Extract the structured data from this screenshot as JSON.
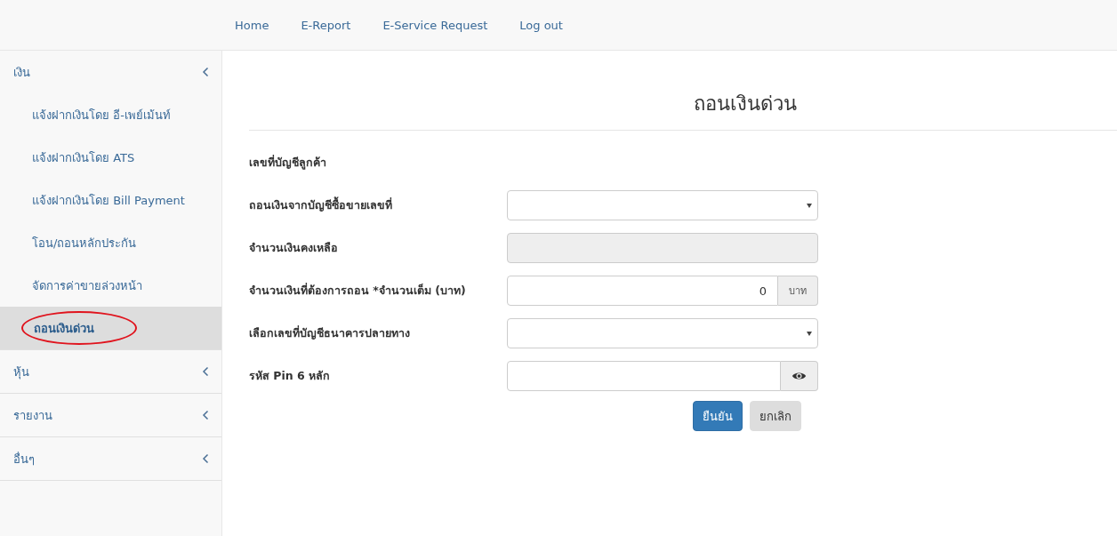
{
  "top_nav": [
    {
      "label": "Home"
    },
    {
      "label": "E-Report"
    },
    {
      "label": "E-Service Request"
    },
    {
      "label": "Log out"
    }
  ],
  "sidebar": {
    "groups": [
      {
        "label": "เงิน",
        "children": [
          {
            "label": "แจ้งฝากเงินโดย อี-เพย์เม้นท์",
            "selected": false,
            "circled": false
          },
          {
            "label": "แจ้งฝากเงินโดย ATS",
            "selected": false,
            "circled": false
          },
          {
            "label": "แจ้งฝากเงินโดย Bill Payment",
            "selected": false,
            "circled": false
          },
          {
            "label": "โอน/ถอนหลักประกัน",
            "selected": false,
            "circled": false
          },
          {
            "label": "จัดการค่าขายล่วงหน้า",
            "selected": false,
            "circled": false
          },
          {
            "label": "ถอนเงินด่วน",
            "selected": true,
            "circled": true
          }
        ]
      },
      {
        "label": "หุ้น"
      },
      {
        "label": "รายงาน"
      },
      {
        "label": "อื่นๆ"
      }
    ]
  },
  "page": {
    "title": "ถอนเงินด่วน",
    "fields": [
      {
        "kind": "label",
        "label": "เลขที่บัญชีลูกค้า"
      },
      {
        "kind": "select",
        "label": "ถอนเงินจากบัญชีซื้อขายเลขที่"
      },
      {
        "kind": "readonly",
        "label": "จำนวนเงินคงเหลือ"
      },
      {
        "kind": "amount",
        "label": "จำนวนเงินที่ต้องการถอน *จำนวนเต็ม (บาท)",
        "value": "0",
        "addon": "บาท"
      },
      {
        "kind": "select",
        "label": "เลือกเลขที่บัญชีธนาคารปลายทาง"
      },
      {
        "kind": "pin",
        "label": "รหัส Pin 6 หลัก"
      }
    ],
    "buttons": [
      {
        "label": "ยืนยัน",
        "kind": "primary"
      },
      {
        "label": "ยกเลิก",
        "kind": "default"
      }
    ]
  }
}
